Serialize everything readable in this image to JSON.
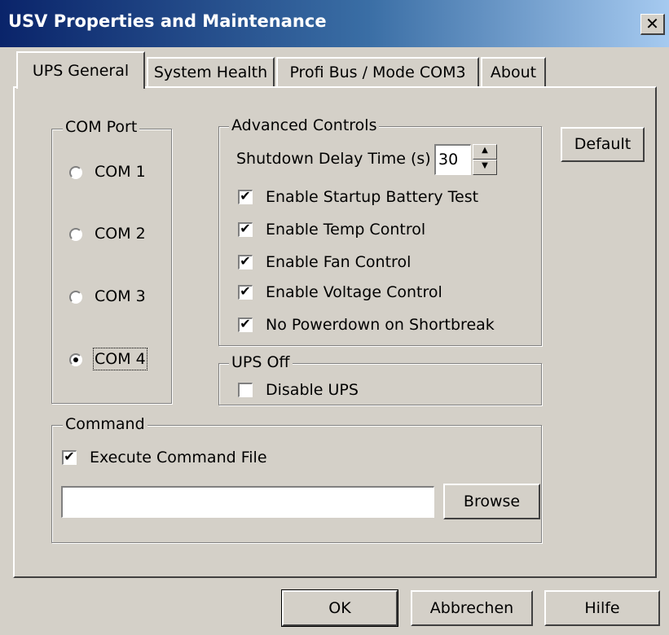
{
  "window": {
    "title": "USV Properties and Maintenance",
    "close_glyph": "✕"
  },
  "tabs": [
    {
      "label": "UPS General",
      "active": true
    },
    {
      "label": "System Health",
      "active": false
    },
    {
      "label": "Profi Bus / Mode COM3",
      "active": false
    },
    {
      "label": "About",
      "active": false
    }
  ],
  "com_port": {
    "legend": "COM Port",
    "options": [
      {
        "label": "COM 1",
        "selected": false
      },
      {
        "label": "COM 2",
        "selected": false
      },
      {
        "label": "COM 3",
        "selected": false
      },
      {
        "label": "COM 4",
        "selected": true
      }
    ]
  },
  "advanced": {
    "legend": "Advanced Controls",
    "delay_label": "Shutdown Delay Time (s)",
    "delay_value": "30",
    "spin_up": "▲",
    "spin_down": "▼",
    "checks": [
      {
        "label": "Enable Startup Battery Test",
        "checked": true
      },
      {
        "label": "Enable Temp Control",
        "checked": true
      },
      {
        "label": "Enable Fan Control",
        "checked": true
      },
      {
        "label": "Enable Voltage Control",
        "checked": true
      },
      {
        "label": "No Powerdown on Shortbreak",
        "checked": true
      }
    ]
  },
  "ups_off": {
    "legend": "UPS Off",
    "disable_label": "Disable UPS",
    "disable_checked": false
  },
  "command": {
    "legend": "Command",
    "execute_label": "Execute Command File",
    "execute_checked": true,
    "path_value": "",
    "browse_label": "Browse"
  },
  "default_button": "Default",
  "footer": {
    "ok": "OK",
    "cancel": "Abbrechen",
    "help": "Hilfe"
  },
  "check_glyph": "✔"
}
